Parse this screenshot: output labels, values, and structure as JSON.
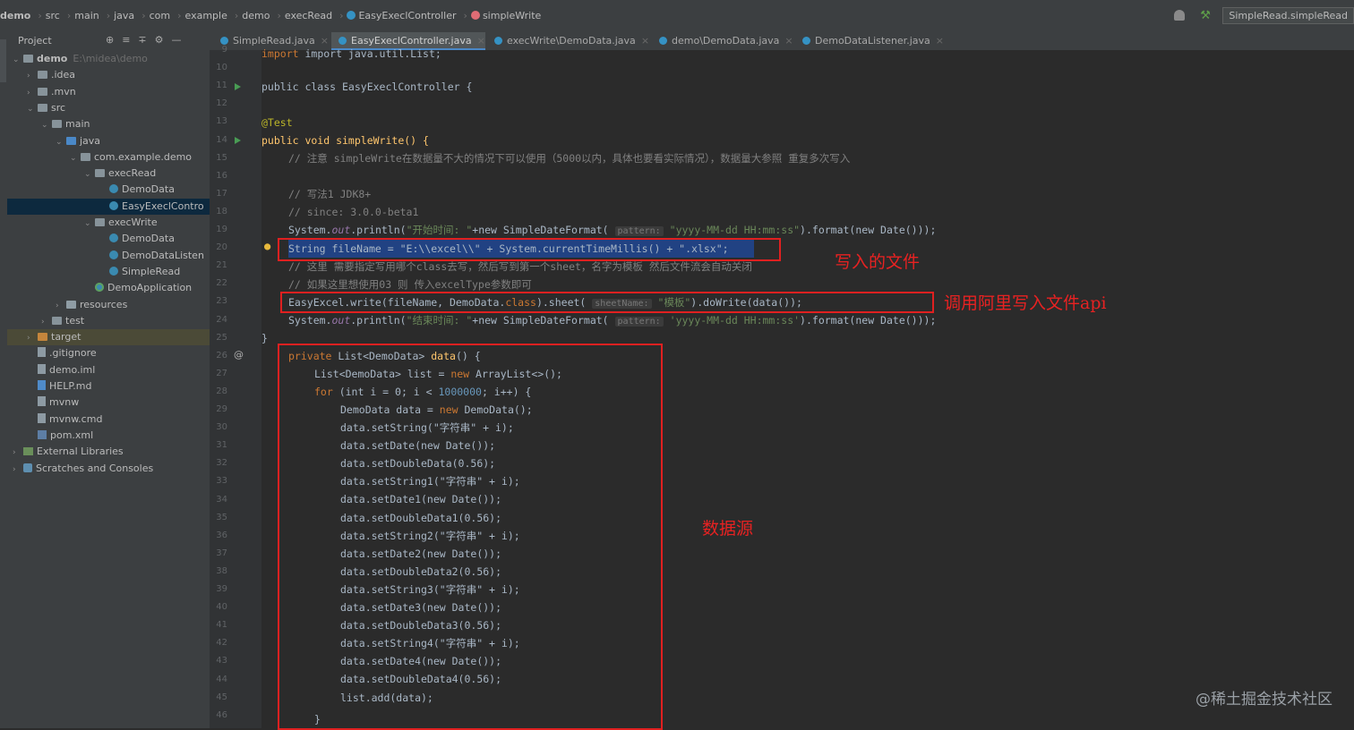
{
  "breadcrumb": [
    "demo",
    "src",
    "main",
    "java",
    "com",
    "example",
    "demo",
    "execRead",
    "EasyExeclController",
    "simpleWrite"
  ],
  "run_config": "SimpleRead.simpleRead",
  "project_panel": {
    "title": "Project",
    "tree": [
      {
        "label": "demo",
        "hint": "E:\\midea\\demo",
        "depth": 0,
        "arrow": "v",
        "icon": "folder"
      },
      {
        "label": ".idea",
        "depth": 1,
        "arrow": ">",
        "icon": "folder"
      },
      {
        "label": ".mvn",
        "depth": 1,
        "arrow": ">",
        "icon": "folder"
      },
      {
        "label": "src",
        "depth": 1,
        "arrow": "v",
        "icon": "folder"
      },
      {
        "label": "main",
        "depth": 2,
        "arrow": "v",
        "icon": "folder"
      },
      {
        "label": "java",
        "depth": 3,
        "arrow": "v",
        "icon": "folder-blue"
      },
      {
        "label": "com.example.demo",
        "depth": 4,
        "arrow": "v",
        "icon": "folder"
      },
      {
        "label": "execRead",
        "depth": 5,
        "arrow": "v",
        "icon": "folder"
      },
      {
        "label": "DemoData",
        "depth": 6,
        "arrow": "",
        "icon": "class"
      },
      {
        "label": "EasyExeclContro",
        "depth": 6,
        "arrow": "",
        "icon": "class",
        "selected": true
      },
      {
        "label": "execWrite",
        "depth": 5,
        "arrow": "v",
        "icon": "folder"
      },
      {
        "label": "DemoData",
        "depth": 6,
        "arrow": "",
        "icon": "class"
      },
      {
        "label": "DemoDataListen",
        "depth": 6,
        "arrow": "",
        "icon": "class"
      },
      {
        "label": "SimpleRead",
        "depth": 6,
        "arrow": "",
        "icon": "class"
      },
      {
        "label": "DemoApplication",
        "depth": 5,
        "arrow": "",
        "icon": "app"
      },
      {
        "label": "resources",
        "depth": 3,
        "arrow": ">",
        "icon": "folder-res"
      },
      {
        "label": "test",
        "depth": 2,
        "arrow": ">",
        "icon": "folder"
      },
      {
        "label": "target",
        "depth": 1,
        "arrow": ">",
        "icon": "folder-orange",
        "highlight": true
      },
      {
        "label": ".gitignore",
        "depth": 1,
        "arrow": "",
        "icon": "file"
      },
      {
        "label": "demo.iml",
        "depth": 1,
        "arrow": "",
        "icon": "file"
      },
      {
        "label": "HELP.md",
        "depth": 1,
        "arrow": "",
        "icon": "md"
      },
      {
        "label": "mvnw",
        "depth": 1,
        "arrow": "",
        "icon": "file"
      },
      {
        "label": "mvnw.cmd",
        "depth": 1,
        "arrow": "",
        "icon": "file"
      },
      {
        "label": "pom.xml",
        "depth": 1,
        "arrow": "",
        "icon": "pom"
      },
      {
        "label": "External Libraries",
        "depth": 0,
        "arrow": ">",
        "icon": "lib"
      },
      {
        "label": "Scratches and Consoles",
        "depth": 0,
        "arrow": ">",
        "icon": "scratch"
      }
    ]
  },
  "tabs": [
    {
      "label": "SimpleRead.java",
      "active": false
    },
    {
      "label": "EasyExeclController.java",
      "active": true
    },
    {
      "label": "execWrite\\DemoData.java",
      "active": false
    },
    {
      "label": "demo\\DemoData.java",
      "active": false
    },
    {
      "label": "DemoDataListener.java",
      "active": false
    }
  ],
  "line_numbers": [
    "9",
    "10",
    "11",
    "12",
    "13",
    "14",
    "15",
    "16",
    "17",
    "18",
    "19",
    "20",
    "21",
    "22",
    "23",
    "24",
    "25",
    "26",
    "27",
    "28",
    "29",
    "30",
    "31",
    "32",
    "33",
    "34",
    "35",
    "36",
    "37",
    "38",
    "39",
    "40",
    "41",
    "42",
    "43",
    "44",
    "45",
    "46"
  ],
  "code": {
    "l_import": "import java.util.List;",
    "l_class": "public class EasyExeclController {",
    "l_test": "@Test",
    "l_method": "public void simpleWrite() {",
    "l_c1": "// 注意 simpleWrite在数据量不大的情况下可以使用（5000以内，具体也要看实际情况），数据量大参照 重复多次写入",
    "l_c2": "// 写法1 JDK8+",
    "l_c3": "// since: 3.0.0-beta1",
    "l_print1_a": "System.",
    "l_print1_b": "out",
    "l_print1_c": ".println(",
    "l_print1_d": "\"开始时间: \"",
    "l_print1_e": "+new SimpleDateFormat(",
    "l_print1_hint": "pattern:",
    "l_print1_f": "\"yyyy-MM-dd HH:mm:ss\"",
    "l_print1_g": ").format(new Date()));",
    "l_filename": "String fileName = \"E:\\\\excel\\\\\" + System.currentTimeMillis() + \".xlsx\";",
    "l_c4": "// 这里 需要指定写用哪个class去写，然后写到第一个sheet，名字为模板 然后文件流会自动关闭",
    "l_c5": "// 如果这里想使用03 则 传入excelType参数即可",
    "l_write_a": "EasyExcel.write(fileName, DemoData.",
    "l_write_b": "class",
    "l_write_c": ").sheet(",
    "l_write_hint": "sheetName:",
    "l_write_d": "\"模板\"",
    "l_write_e": ").doWrite(data());",
    "l_print2_a": "System.",
    "l_print2_b": "out",
    "l_print2_c": ".println(",
    "l_print2_d": "\"结束时间: \"",
    "l_print2_e": "+new SimpleDateFormat(",
    "l_print2_hint": "pattern:",
    "l_print2_f": "'yyyy-MM-dd HH:mm:ss'",
    "l_print2_g": ").format(new Date()));",
    "l_close": "}",
    "l_data_a": "private",
    "l_data_b": " List<DemoData> ",
    "l_data_c": "data",
    "l_data_d": "() {",
    "l_list_a": "List<DemoData> list = ",
    "l_list_b": "new",
    "l_list_c": " ArrayList<>();",
    "l_for_a": "for",
    "l_for_b": " (int i = 0; i < ",
    "l_for_c": "1000000",
    "l_for_d": "; i++) {",
    "l_new_a": "DemoData data = ",
    "l_new_b": "new",
    "l_new_c": " DemoData();",
    "body_lines": [
      "data.setString(\"字符串\" + i);",
      "data.setDate(new Date());",
      "data.setDoubleData(0.56);",
      "data.setString1(\"字符串\" + i);",
      "data.setDate1(new Date());",
      "data.setDoubleData1(0.56);",
      "data.setString2(\"字符串\" + i);",
      "data.setDate2(new Date());",
      "data.setDoubleData2(0.56);",
      "data.setString3(\"字符串\" + i);",
      "data.setDate3(new Date());",
      "data.setDoubleData3(0.56);",
      "data.setString4(\"字符串\" + i);",
      "data.setDate4(new Date());",
      "data.setDoubleData4(0.56);",
      "list.add(data);"
    ],
    "l_inner_close": "}"
  },
  "annotations": {
    "file_label": "写入的文件",
    "api_label": "调用阿里写入文件api",
    "source_label": "数据源"
  },
  "watermark": "@稀土掘金技术社区",
  "colors": {
    "annotation_red": "#e02020",
    "selection_blue": "#214283",
    "editor_bg": "#2b2b2b"
  }
}
